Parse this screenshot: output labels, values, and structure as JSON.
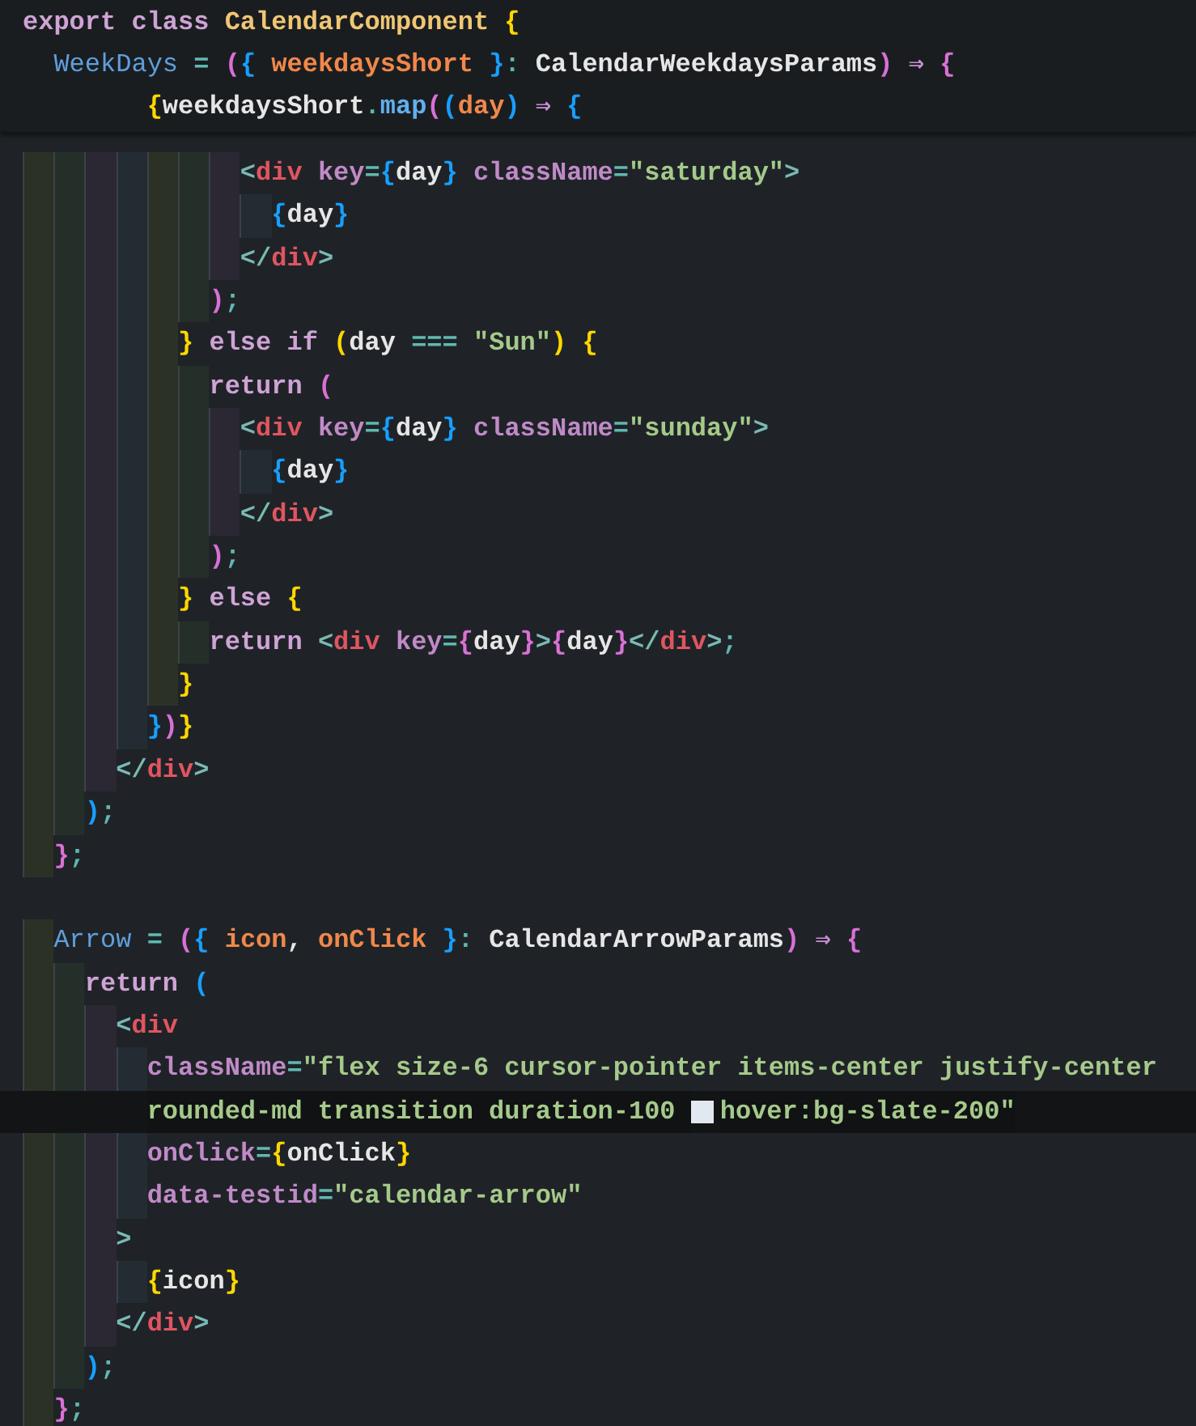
{
  "sticky_header": [
    {
      "tokens": [
        {
          "kind": "keyword",
          "text": "export class "
        },
        {
          "kind": "class",
          "text": "CalendarComponent "
        },
        {
          "kind": "bracket1",
          "text": "{"
        }
      ],
      "children": [
        {
          "tokens": [
            {
              "kind": "name",
              "text": "WeekDays"
            },
            {
              "kind": "operator",
              "text": " = "
            },
            {
              "kind": "bracket2",
              "text": "("
            },
            {
              "kind": "bracket3",
              "text": "{"
            },
            {
              "kind": "param",
              "text": " weekdaysShort "
            },
            {
              "kind": "bracket3",
              "text": "}"
            },
            {
              "kind": "operator",
              "text": ": "
            },
            {
              "kind": "plain",
              "text": "CalendarWeekdaysParams"
            },
            {
              "kind": "bracket2",
              "text": ")"
            },
            {
              "kind": "arrow",
              "text": " ⇒ "
            },
            {
              "kind": "bracket2",
              "text": "{"
            }
          ],
          "children": [
            {
              "children": [
                {
                  "children": [
                    {
                      "tokens": [
                        {
                          "kind": "bracket1",
                          "text": "{"
                        },
                        {
                          "kind": "plain",
                          "text": "weekdaysShort"
                        },
                        {
                          "kind": "operator",
                          "text": "."
                        },
                        {
                          "kind": "func",
                          "text": "map"
                        },
                        {
                          "kind": "bracket2",
                          "text": "("
                        },
                        {
                          "kind": "bracket3",
                          "text": "("
                        },
                        {
                          "kind": "param",
                          "text": "day"
                        },
                        {
                          "kind": "bracket3",
                          "text": ")"
                        },
                        {
                          "kind": "arrow",
                          "text": " ⇒ "
                        },
                        {
                          "kind": "bracket3",
                          "text": "{"
                        }
                      ]
                    }
                  ]
                }
              ]
            }
          ]
        }
      ]
    }
  ],
  "lines": [
    {
      "children": [
        {
          "children": [
            {
              "children": [
                {
                  "children": [
                    {
                      "children": [
                        {
                          "children": [
                            {
                              "children": [
                                {
                                  "tokens": [
                                    {
                                      "kind": "punct",
                                      "text": "<"
                                    },
                                    {
                                      "kind": "tag",
                                      "text": "div"
                                    },
                                    {
                                      "kind": "attribute",
                                      "text": " key"
                                    },
                                    {
                                      "kind": "operator",
                                      "text": "="
                                    },
                                    {
                                      "kind": "bracket3",
                                      "text": "{"
                                    },
                                    {
                                      "kind": "plain",
                                      "text": "day"
                                    },
                                    {
                                      "kind": "bracket3",
                                      "text": "}"
                                    },
                                    {
                                      "kind": "attribute",
                                      "text": " className"
                                    },
                                    {
                                      "kind": "operator",
                                      "text": "="
                                    },
                                    {
                                      "kind": "string",
                                      "text": "\"saturday\""
                                    },
                                    {
                                      "kind": "punct",
                                      "text": ">"
                                    }
                                  ],
                                  "children": [
                                    {
                                      "tokens": [
                                        {
                                          "kind": "bracket3",
                                          "text": "{"
                                        },
                                        {
                                          "kind": "plain",
                                          "text": "day"
                                        },
                                        {
                                          "kind": "bracket3",
                                          "text": "}"
                                        }
                                      ]
                                    }
                                  ]
                                },
                                {
                                  "tokens": [
                                    {
                                      "kind": "punct",
                                      "text": "</"
                                    },
                                    {
                                      "kind": "tag",
                                      "text": "div"
                                    },
                                    {
                                      "kind": "punct",
                                      "text": ">"
                                    }
                                  ]
                                }
                              ]
                            },
                            {
                              "tokens": [
                                {
                                  "kind": "bracket2",
                                  "text": ")"
                                },
                                {
                                  "kind": "operator",
                                  "text": ";"
                                }
                              ]
                            }
                          ]
                        },
                        {
                          "tokens": [
                            {
                              "kind": "bracket1",
                              "text": "}"
                            },
                            {
                              "kind": "keyword",
                              "text": " else if "
                            },
                            {
                              "kind": "bracket1",
                              "text": "("
                            },
                            {
                              "kind": "plain",
                              "text": "day"
                            },
                            {
                              "kind": "operator",
                              "text": " === "
                            },
                            {
                              "kind": "string",
                              "text": "\"Sun\""
                            },
                            {
                              "kind": "bracket1",
                              "text": ") {"
                            }
                          ],
                          "children": [
                            {
                              "tokens": [
                                {
                                  "kind": "keyword",
                                  "text": "return "
                                },
                                {
                                  "kind": "bracket2",
                                  "text": "("
                                }
                              ],
                              "children": [
                                {
                                  "tokens": [
                                    {
                                      "kind": "punct",
                                      "text": "<"
                                    },
                                    {
                                      "kind": "tag",
                                      "text": "div"
                                    },
                                    {
                                      "kind": "attribute",
                                      "text": " key"
                                    },
                                    {
                                      "kind": "operator",
                                      "text": "="
                                    },
                                    {
                                      "kind": "bracket3",
                                      "text": "{"
                                    },
                                    {
                                      "kind": "plain",
                                      "text": "day"
                                    },
                                    {
                                      "kind": "bracket3",
                                      "text": "}"
                                    },
                                    {
                                      "kind": "attribute",
                                      "text": " className"
                                    },
                                    {
                                      "kind": "operator",
                                      "text": "="
                                    },
                                    {
                                      "kind": "string",
                                      "text": "\"sunday\""
                                    },
                                    {
                                      "kind": "punct",
                                      "text": ">"
                                    }
                                  ],
                                  "children": [
                                    {
                                      "tokens": [
                                        {
                                          "kind": "bracket3",
                                          "text": "{"
                                        },
                                        {
                                          "kind": "plain",
                                          "text": "day"
                                        },
                                        {
                                          "kind": "bracket3",
                                          "text": "}"
                                        }
                                      ]
                                    }
                                  ]
                                },
                                {
                                  "tokens": [
                                    {
                                      "kind": "punct",
                                      "text": "</"
                                    },
                                    {
                                      "kind": "tag",
                                      "text": "div"
                                    },
                                    {
                                      "kind": "punct",
                                      "text": ">"
                                    }
                                  ]
                                }
                              ]
                            },
                            {
                              "tokens": [
                                {
                                  "kind": "bracket2",
                                  "text": ")"
                                },
                                {
                                  "kind": "operator",
                                  "text": ";"
                                }
                              ]
                            }
                          ]
                        },
                        {
                          "tokens": [
                            {
                              "kind": "bracket1",
                              "text": "}"
                            },
                            {
                              "kind": "keyword",
                              "text": " else "
                            },
                            {
                              "kind": "bracket1",
                              "text": "{"
                            }
                          ],
                          "children": [
                            {
                              "tokens": [
                                {
                                  "kind": "keyword",
                                  "text": "return "
                                },
                                {
                                  "kind": "punct",
                                  "text": "<"
                                },
                                {
                                  "kind": "tag",
                                  "text": "div"
                                },
                                {
                                  "kind": "attribute",
                                  "text": " key"
                                },
                                {
                                  "kind": "operator",
                                  "text": "="
                                },
                                {
                                  "kind": "bracket2",
                                  "text": "{"
                                },
                                {
                                  "kind": "plain",
                                  "text": "day"
                                },
                                {
                                  "kind": "bracket2",
                                  "text": "}"
                                },
                                {
                                  "kind": "punct",
                                  "text": ">"
                                },
                                {
                                  "kind": "bracket2",
                                  "text": "{"
                                },
                                {
                                  "kind": "plain",
                                  "text": "day"
                                },
                                {
                                  "kind": "bracket2",
                                  "text": "}"
                                },
                                {
                                  "kind": "punct",
                                  "text": "</"
                                },
                                {
                                  "kind": "tag",
                                  "text": "div"
                                },
                                {
                                  "kind": "punct",
                                  "text": ">"
                                },
                                {
                                  "kind": "operator",
                                  "text": ";"
                                }
                              ]
                            }
                          ]
                        },
                        {
                          "tokens": [
                            {
                              "kind": "bracket1",
                              "text": "}"
                            }
                          ]
                        }
                      ]
                    },
                    {
                      "tokens": [
                        {
                          "kind": "bracket3",
                          "text": "}"
                        },
                        {
                          "kind": "bracket2",
                          "text": ")"
                        },
                        {
                          "kind": "bracket1",
                          "text": "}"
                        }
                      ]
                    }
                  ]
                },
                {
                  "tokens": [
                    {
                      "kind": "punct",
                      "text": "</"
                    },
                    {
                      "kind": "tag",
                      "text": "div"
                    },
                    {
                      "kind": "punct",
                      "text": ">"
                    }
                  ]
                }
              ]
            },
            {
              "tokens": [
                {
                  "kind": "bracket3",
                  "text": ")"
                },
                {
                  "kind": "operator",
                  "text": ";"
                }
              ]
            }
          ]
        },
        {
          "tokens": [
            {
              "kind": "bracket2",
              "text": "}"
            },
            {
              "kind": "operator",
              "text": ";"
            }
          ]
        },
        {
          "gap_before": true,
          "tokens": [
            {
              "kind": "name",
              "text": "Arrow"
            },
            {
              "kind": "operator",
              "text": " = "
            },
            {
              "kind": "bracket2",
              "text": "("
            },
            {
              "kind": "bracket3",
              "text": "{"
            },
            {
              "kind": "param",
              "text": " icon"
            },
            {
              "kind": "plain",
              "text": ", "
            },
            {
              "kind": "param",
              "text": "onClick "
            },
            {
              "kind": "bracket3",
              "text": "}"
            },
            {
              "kind": "operator",
              "text": ": "
            },
            {
              "kind": "plain",
              "text": "CalendarArrowParams"
            },
            {
              "kind": "bracket2",
              "text": ")"
            },
            {
              "kind": "arrow",
              "text": " ⇒ "
            },
            {
              "kind": "bracket2",
              "text": "{"
            }
          ],
          "children": [
            {
              "tokens": [
                {
                  "kind": "keyword",
                  "text": "return "
                },
                {
                  "kind": "bracket3",
                  "text": "("
                }
              ],
              "children": [
                {
                  "tokens": [
                    {
                      "kind": "punct",
                      "text": "<"
                    },
                    {
                      "kind": "tag",
                      "text": "div"
                    }
                  ],
                  "children": [
                    {
                      "tokens": [
                        {
                          "kind": "attribute",
                          "text": "className"
                        },
                        {
                          "kind": "operator",
                          "text": "="
                        },
                        {
                          "kind": "string",
                          "text": "\"flex size-6 cursor-pointer items-center justify-center"
                        }
                      ]
                    },
                    {
                      "wrapped": true,
                      "current": true,
                      "tokens": [
                        {
                          "kind": "string",
                          "text": "rounded-md transition duration-100 "
                        },
                        {
                          "kind": "swatch",
                          "color": "#e2e8f0"
                        },
                        {
                          "kind": "string",
                          "text": "hover:bg-slate-200\""
                        }
                      ]
                    },
                    {
                      "tokens": [
                        {
                          "kind": "attribute",
                          "text": "onClick"
                        },
                        {
                          "kind": "operator",
                          "text": "="
                        },
                        {
                          "kind": "bracket1",
                          "text": "{"
                        },
                        {
                          "kind": "plain",
                          "text": "onClick"
                        },
                        {
                          "kind": "bracket1",
                          "text": "}"
                        }
                      ]
                    },
                    {
                      "tokens": [
                        {
                          "kind": "attribute",
                          "text": "data-testid"
                        },
                        {
                          "kind": "operator",
                          "text": "="
                        },
                        {
                          "kind": "string",
                          "text": "\"calendar-arrow\""
                        }
                      ]
                    }
                  ]
                },
                {
                  "tokens": [
                    {
                      "kind": "punct",
                      "text": ">"
                    }
                  ],
                  "children": [
                    {
                      "tokens": [
                        {
                          "kind": "bracket1",
                          "text": "{"
                        },
                        {
                          "kind": "plain",
                          "text": "icon"
                        },
                        {
                          "kind": "bracket1",
                          "text": "}"
                        }
                      ]
                    }
                  ]
                },
                {
                  "tokens": [
                    {
                      "kind": "punct",
                      "text": "</"
                    },
                    {
                      "kind": "tag",
                      "text": "div"
                    },
                    {
                      "kind": "punct",
                      "text": ">"
                    }
                  ]
                }
              ]
            },
            {
              "tokens": [
                {
                  "kind": "bracket3",
                  "text": ")"
                },
                {
                  "kind": "operator",
                  "text": ";"
                }
              ]
            }
          ]
        },
        {
          "tokens": [
            {
              "kind": "bracket2",
              "text": "}"
            },
            {
              "kind": "operator",
              "text": ";"
            }
          ]
        }
      ]
    }
  ]
}
